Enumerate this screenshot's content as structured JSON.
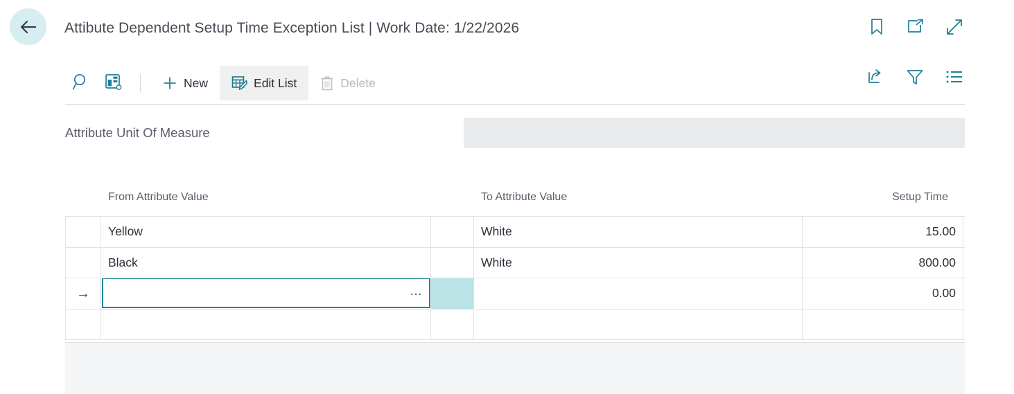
{
  "header": {
    "back_icon": "arrow-left-icon",
    "title": "Attibute Dependent Setup Time Exception List | Work Date: 1/22/2026",
    "window_actions": [
      {
        "name": "bookmark-icon",
        "label": "Bookmark"
      },
      {
        "name": "open-in-new-window-icon",
        "label": "Open in new window"
      },
      {
        "name": "expand-icon",
        "label": "Expand"
      }
    ]
  },
  "toolbar": {
    "search_icon": "search-icon",
    "focus_mode_icon": "page-layout-icon",
    "new_label": "New",
    "edit_list_label": "Edit List",
    "delete_label": "Delete",
    "delete_disabled": true,
    "right_actions": [
      {
        "name": "share-icon",
        "label": "Share"
      },
      {
        "name": "filter-icon",
        "label": "Filter"
      },
      {
        "name": "list-options-icon",
        "label": "Options"
      }
    ]
  },
  "filter": {
    "label": "Attribute Unit Of Measure",
    "value": "",
    "placeholder": ""
  },
  "table": {
    "columns": [
      {
        "key": "selector",
        "label": ""
      },
      {
        "key": "from_attribute_value",
        "label": "From Attribute Value"
      },
      {
        "key": "gap",
        "label": ""
      },
      {
        "key": "to_attribute_value",
        "label": "To Attribute Value"
      },
      {
        "key": "setup_time",
        "label": "Setup Time"
      }
    ],
    "rows": [
      {
        "selected": false,
        "from_attribute_value": "Yellow",
        "to_attribute_value": "White",
        "setup_time": "15.00"
      },
      {
        "selected": false,
        "from_attribute_value": "Black",
        "to_attribute_value": "White",
        "setup_time": "800.00"
      },
      {
        "selected": true,
        "editing": true,
        "row_indicator": "→",
        "from_attribute_value": "",
        "lookup_label": "…",
        "to_attribute_value": "",
        "setup_time": "0.00"
      },
      {
        "selected": false,
        "from_attribute_value": "",
        "to_attribute_value": "",
        "setup_time": ""
      }
    ]
  },
  "colors": {
    "accent_teal": "#1d8a96",
    "highlight_cell": "#b9e3e5",
    "back_circle": "#d6edf1",
    "field_background": "#e9eaec",
    "footer_background": "#f4f5f7",
    "grid_line": "#e2e2e6"
  }
}
